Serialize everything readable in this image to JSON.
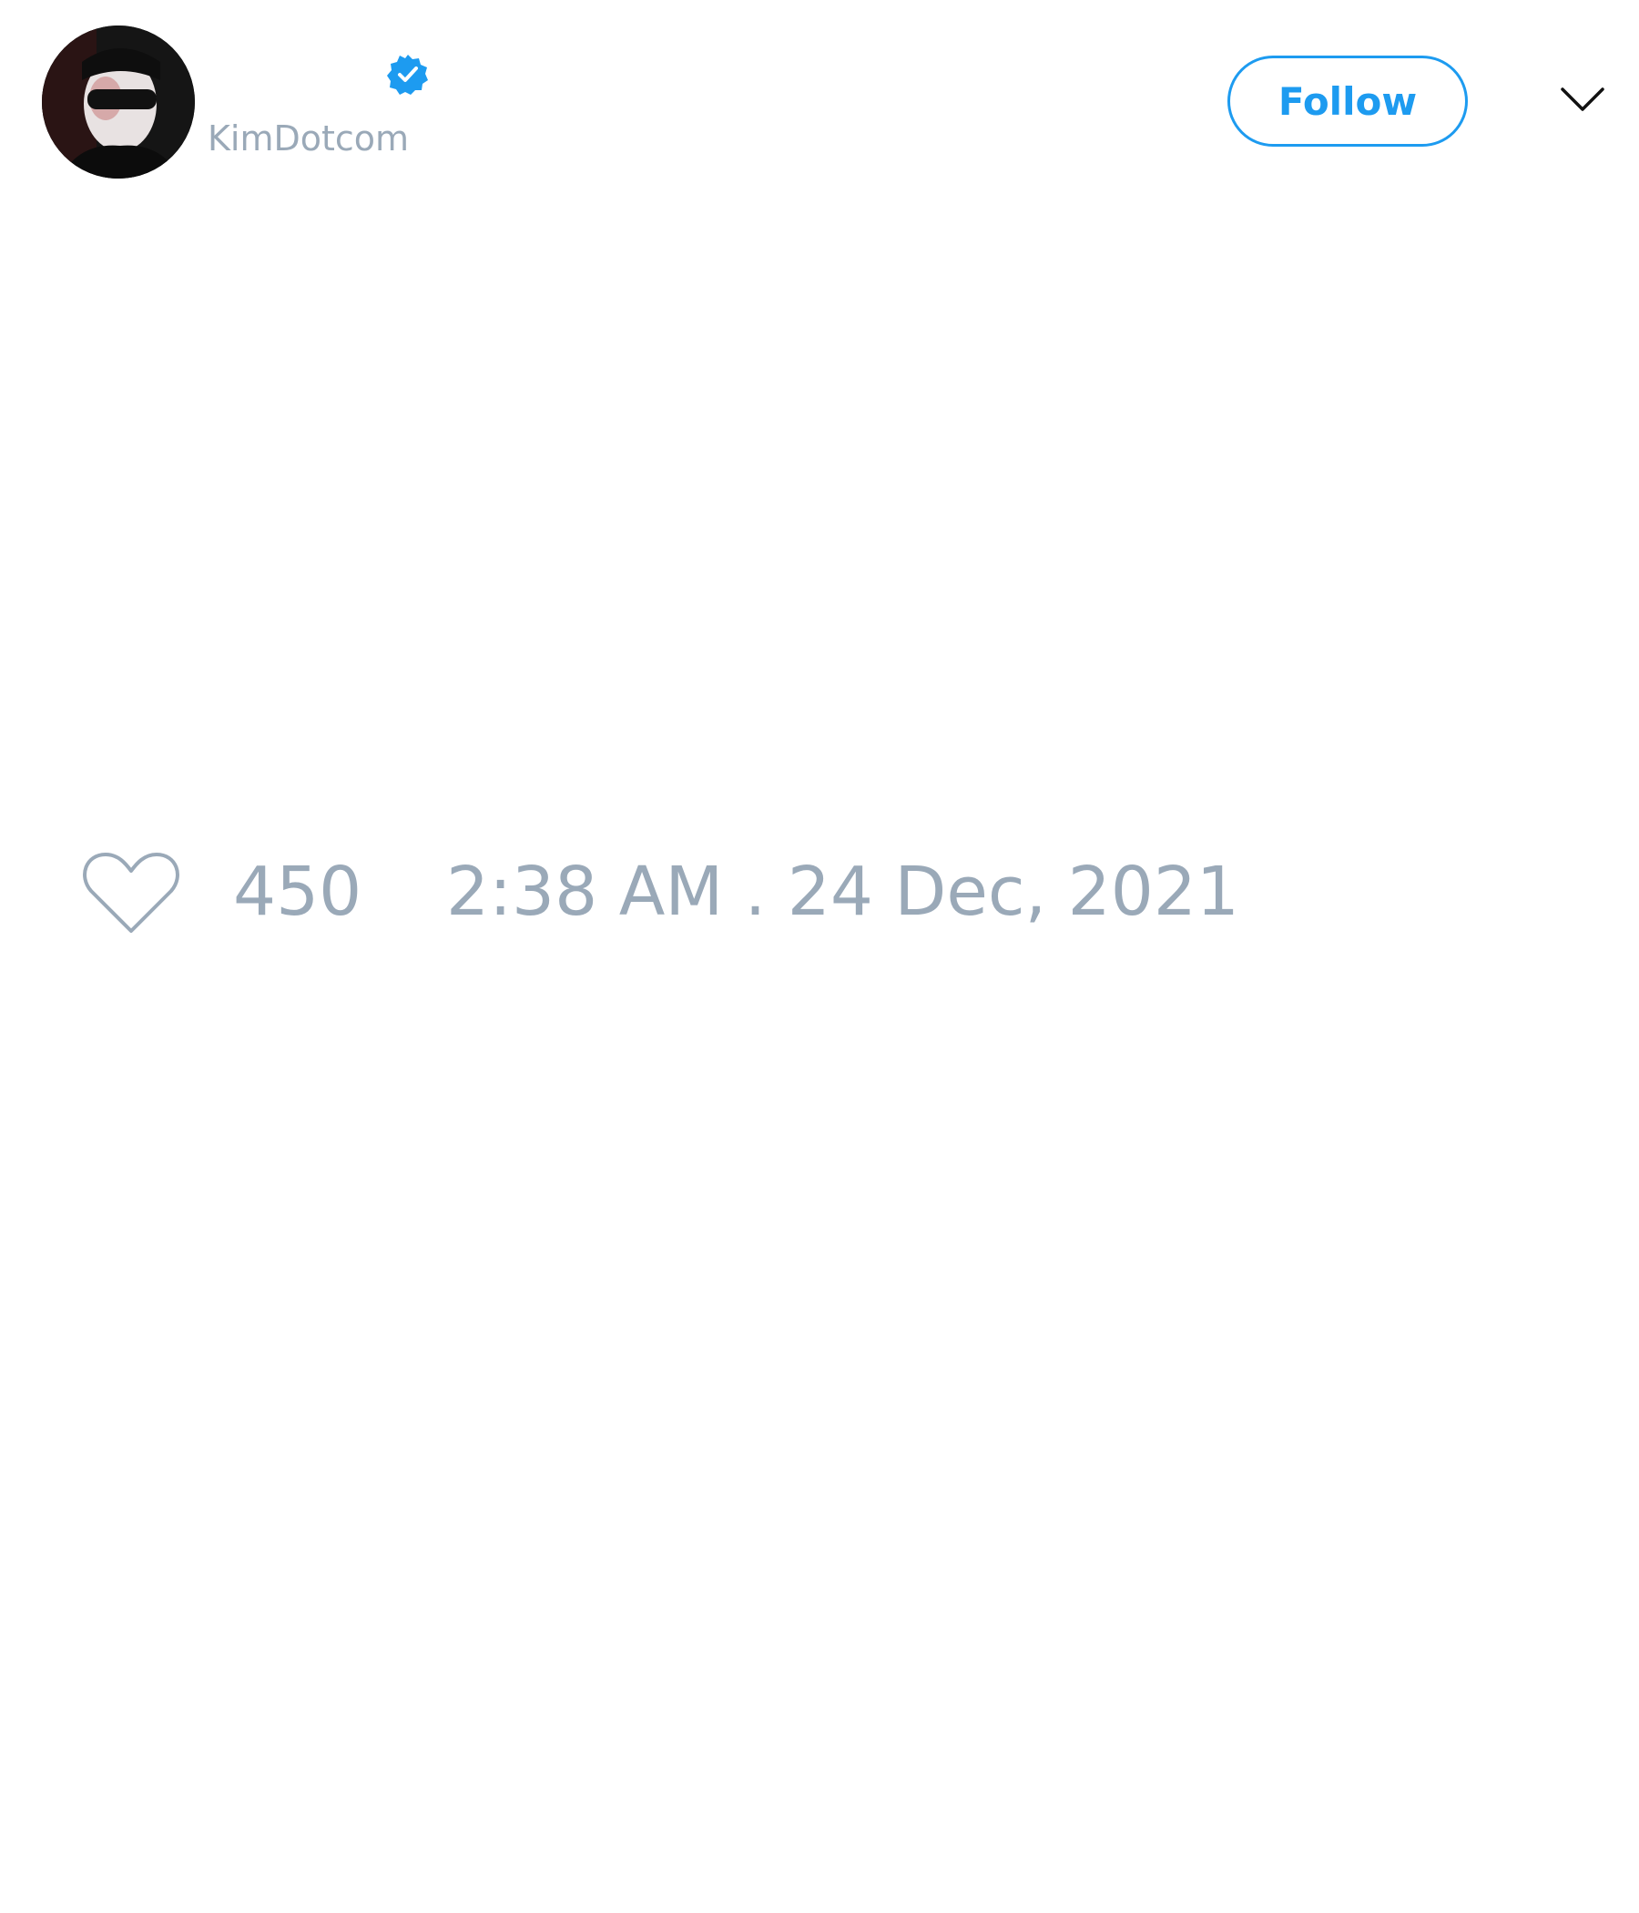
{
  "author": {
    "handle": "KimDotcom",
    "verified": true,
    "avatar_icon": "profile-photo"
  },
  "header": {
    "follow_label": "Follow",
    "more_icon": "chevron-down-icon"
  },
  "tweet_footer": {
    "like_icon": "heart-outline-icon",
    "like_count": "450",
    "timestamp": "2:38 AM . 24 Dec, 2021"
  },
  "colors": {
    "accent": "#1d9bf0",
    "muted_text": "#9aa9b8",
    "background": "#ffffff"
  }
}
